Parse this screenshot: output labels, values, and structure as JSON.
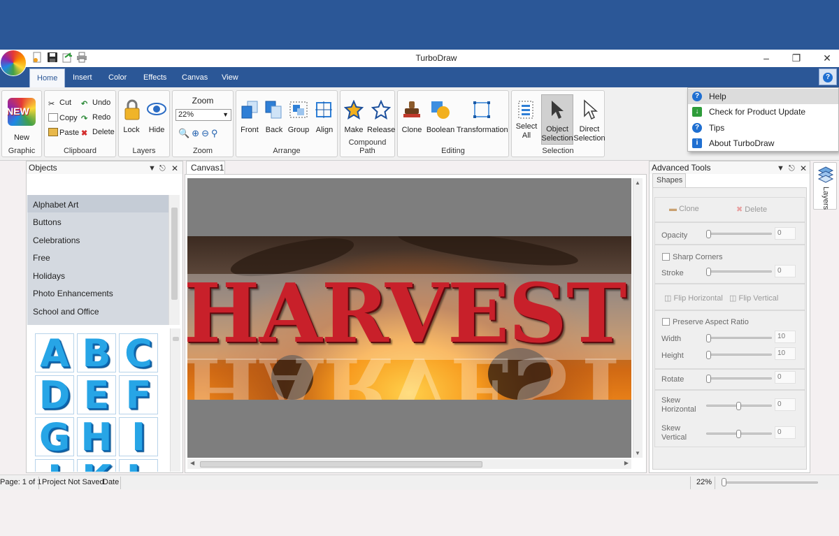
{
  "window": {
    "title": "TurboDraw"
  },
  "ribbon_tabs": [
    "Home",
    "Insert",
    "Color",
    "Effects",
    "Canvas",
    "View"
  ],
  "ribbon": {
    "graphic": {
      "new_label": "New",
      "group": "Graphic",
      "badge": "NEW"
    },
    "clipboard": {
      "cut": "Cut",
      "copy": "Copy",
      "paste": "Paste",
      "undo": "Undo",
      "redo": "Redo",
      "delete": "Delete",
      "group": "Clipboard"
    },
    "layers": {
      "lock": "Lock",
      "hide": "Hide",
      "group": "Layers"
    },
    "zoom": {
      "title": "Zoom",
      "value": "22%",
      "group": "Zoom"
    },
    "arrange": {
      "front": "Front",
      "back": "Back",
      "group_btn": "Group",
      "align": "Align",
      "group": "Arrange"
    },
    "compound": {
      "make": "Make",
      "release": "Release",
      "group": "Compound Path"
    },
    "editing": {
      "clone": "Clone",
      "boolean": "Boolean",
      "transformation": "Transformation",
      "group": "Editing"
    },
    "selection": {
      "select_all_1": "Select",
      "select_all_2": "All",
      "object_sel_1": "Object",
      "object_sel_2": "Selection",
      "direct_sel_1": "Direct",
      "direct_sel_2": "Selection",
      "group": "Selection"
    }
  },
  "help_menu": [
    "Help",
    "Check for Product Update",
    "Tips",
    "About TurboDraw"
  ],
  "objects_panel": {
    "title": "Objects",
    "categories": [
      "Alphabet Art",
      "Buttons",
      "Celebrations",
      "Free",
      "Holidays",
      "Photo Enhancements",
      "School and Office"
    ],
    "letters": [
      "A",
      "B",
      "C",
      "D",
      "E",
      "F",
      "G",
      "H",
      "I",
      "J",
      "K",
      "L"
    ]
  },
  "canvas": {
    "tab": "Canvas1",
    "text": "HARVEST",
    "reflection": "HARVEST"
  },
  "advanced_tools": {
    "title": "Advanced Tools",
    "tab": "Shapes",
    "clone": "Clone",
    "delete": "Delete",
    "opacity": "Opacity",
    "opacity_value": "0",
    "sharp_corners": "Sharp Corners",
    "stroke": "Stroke",
    "stroke_value": "0",
    "flip_horizontal": "Flip Horizontal",
    "flip_vertical": "Flip Vertical",
    "preserve_aspect": "Preserve Aspect Ratio",
    "width": "Width",
    "width_value": "10",
    "height": "Height",
    "height_value": "10",
    "rotate": "Rotate",
    "rotate_value": "0",
    "skew_h_1": "Skew",
    "skew_h_2": "Horizontal",
    "skew_h_value": "0",
    "skew_v_1": "Skew",
    "skew_v_2": "Vertical",
    "skew_v_value": "0"
  },
  "layers_side": {
    "label": "Layers"
  },
  "status": {
    "page": "Page: 1 of 1",
    "saved": "Project Not Saved",
    "date": "Date",
    "zoom": "22%"
  },
  "colors": {
    "brand_blue": "#2b5797",
    "harvest_red": "#c8202a",
    "letter_blue": "#27a5e6"
  }
}
